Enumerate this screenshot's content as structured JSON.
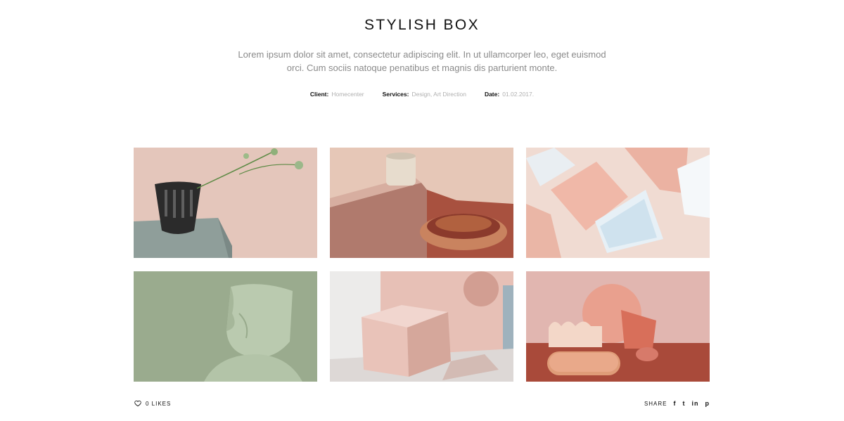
{
  "project": {
    "title": "STYLISH BOX",
    "description": "Lorem ipsum dolor sit amet, consectetur adipiscing elit. In ut ullamcorper leo, eget euismod orci. Cum sociis natoque penatibus et magnis dis parturient monte.",
    "meta": [
      {
        "label": "Client:",
        "value": "Homecenter"
      },
      {
        "label": "Services:",
        "value": "Design, Art Direction"
      },
      {
        "label": "Date:",
        "value": "01.02.2017."
      }
    ]
  },
  "gallery": {
    "images": [
      {
        "name": "black-vase-with-flowers"
      },
      {
        "name": "cup-and-copper-bowls"
      },
      {
        "name": "pink-open-boxes"
      },
      {
        "name": "green-chair"
      },
      {
        "name": "pink-cube"
      },
      {
        "name": "pink-shapes-composition"
      }
    ]
  },
  "footer": {
    "likes_label": "0 LIKES",
    "share_label": "SHARE",
    "share_icons": [
      "f",
      "t",
      "in",
      "p"
    ]
  }
}
